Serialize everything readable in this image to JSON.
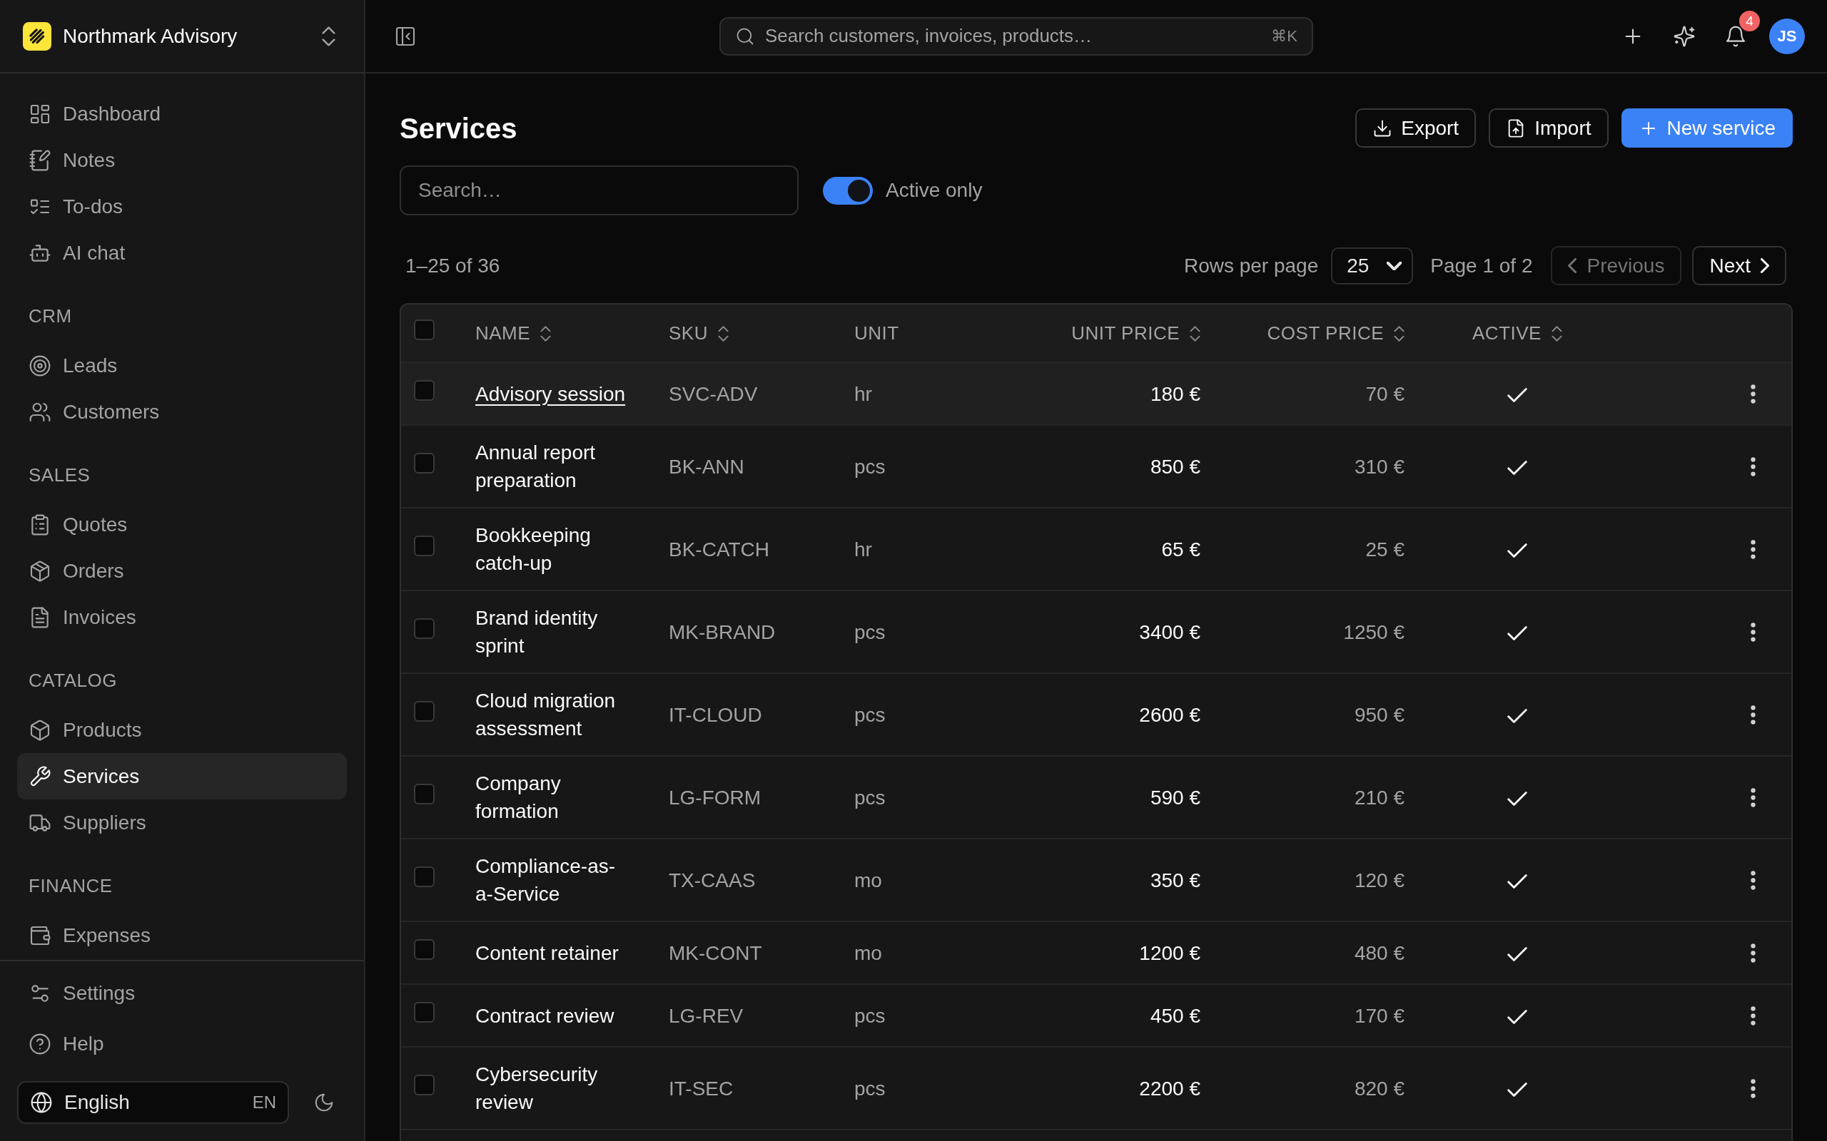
{
  "sidebar": {
    "workspace": "Northmark Advisory",
    "sections": [
      {
        "items": [
          {
            "label": "Dashboard",
            "selected": false
          },
          {
            "label": "Notes",
            "selected": false
          },
          {
            "label": "To-dos",
            "selected": false
          },
          {
            "label": "AI chat",
            "selected": false
          }
        ]
      },
      {
        "title": "CRM",
        "items": [
          {
            "label": "Leads",
            "selected": false
          },
          {
            "label": "Customers",
            "selected": false
          }
        ]
      },
      {
        "title": "SALES",
        "items": [
          {
            "label": "Quotes",
            "selected": false
          },
          {
            "label": "Orders",
            "selected": false
          },
          {
            "label": "Invoices",
            "selected": false
          }
        ]
      },
      {
        "title": "CATALOG",
        "items": [
          {
            "label": "Products",
            "selected": false
          },
          {
            "label": "Services",
            "selected": true
          },
          {
            "label": "Suppliers",
            "selected": false
          }
        ]
      },
      {
        "title": "FINANCE",
        "items": [
          {
            "label": "Expenses",
            "selected": false
          }
        ]
      }
    ],
    "footer_items": [
      {
        "label": "Settings",
        "selected": false
      },
      {
        "label": "Help",
        "selected": false
      }
    ],
    "language": {
      "label": "English",
      "code": "EN"
    }
  },
  "topbar": {
    "search": {
      "placeholder": "Search customers, invoices, products…",
      "shortcut": "⌘K"
    },
    "notifications": {
      "count": "4"
    },
    "user": {
      "initials": "JS"
    }
  },
  "page": {
    "title": "Services",
    "actions": [
      {
        "label": "Export",
        "kind": "secondary"
      },
      {
        "label": "Import",
        "kind": "secondary"
      },
      {
        "label": "New service",
        "kind": "primary"
      }
    ]
  },
  "filters": {
    "search": {
      "placeholder": "Search…"
    },
    "active_only": {
      "label": "Active only",
      "on": true
    }
  },
  "pagination": {
    "range": "1–25 of 36",
    "rows_per_page_label": "Rows per page",
    "rows_per_page": "25",
    "page": "Page 1 of 2",
    "previous": {
      "label": "Previous",
      "disabled": true
    },
    "next": {
      "label": "Next",
      "disabled": false
    }
  },
  "table": {
    "select_all_checked": false,
    "columns": [
      {
        "label": "NAME",
        "sortable": true
      },
      {
        "label": "SKU",
        "sortable": true
      },
      {
        "label": "UNIT",
        "sortable": false
      },
      {
        "label": "UNIT PRICE",
        "sortable": true
      },
      {
        "label": "COST PRICE",
        "sortable": true
      },
      {
        "label": "ACTIVE",
        "sortable": true
      }
    ],
    "rows": [
      {
        "name": "Advisory session",
        "sku": "SVC-ADV",
        "unit": "hr",
        "unit_price": "180 €",
        "cost_price": "70 €",
        "active": true,
        "checked": false,
        "highlighted": true
      },
      {
        "name": "Annual report preparation",
        "sku": "BK-ANN",
        "unit": "pcs",
        "unit_price": "850 €",
        "cost_price": "310 €",
        "active": true,
        "checked": false,
        "highlighted": false
      },
      {
        "name": "Bookkeeping catch-up",
        "sku": "BK-CATCH",
        "unit": "hr",
        "unit_price": "65 €",
        "cost_price": "25 €",
        "active": true,
        "checked": false,
        "highlighted": false
      },
      {
        "name": "Brand identity sprint",
        "sku": "MK-BRAND",
        "unit": "pcs",
        "unit_price": "3400 €",
        "cost_price": "1250 €",
        "active": true,
        "checked": false,
        "highlighted": false
      },
      {
        "name": "Cloud migration assessment",
        "sku": "IT-CLOUD",
        "unit": "pcs",
        "unit_price": "2600 €",
        "cost_price": "950 €",
        "active": true,
        "checked": false,
        "highlighted": false
      },
      {
        "name": "Company formation",
        "sku": "LG-FORM",
        "unit": "pcs",
        "unit_price": "590 €",
        "cost_price": "210 €",
        "active": true,
        "checked": false,
        "highlighted": false
      },
      {
        "name": "Compliance-as-a-Service",
        "sku": "TX-CAAS",
        "unit": "mo",
        "unit_price": "350 €",
        "cost_price": "120 €",
        "active": true,
        "checked": false,
        "highlighted": false
      },
      {
        "name": "Content retainer",
        "sku": "MK-CONT",
        "unit": "mo",
        "unit_price": "1200 €",
        "cost_price": "480 €",
        "active": true,
        "checked": false,
        "highlighted": false
      },
      {
        "name": "Contract review",
        "sku": "LG-REV",
        "unit": "pcs",
        "unit_price": "450 €",
        "cost_price": "170 €",
        "active": true,
        "checked": false,
        "highlighted": false
      },
      {
        "name": "Cybersecurity review",
        "sku": "IT-SEC",
        "unit": "pcs",
        "unit_price": "2200 €",
        "cost_price": "820 €",
        "active": true,
        "checked": false,
        "highlighted": false
      }
    ]
  }
}
